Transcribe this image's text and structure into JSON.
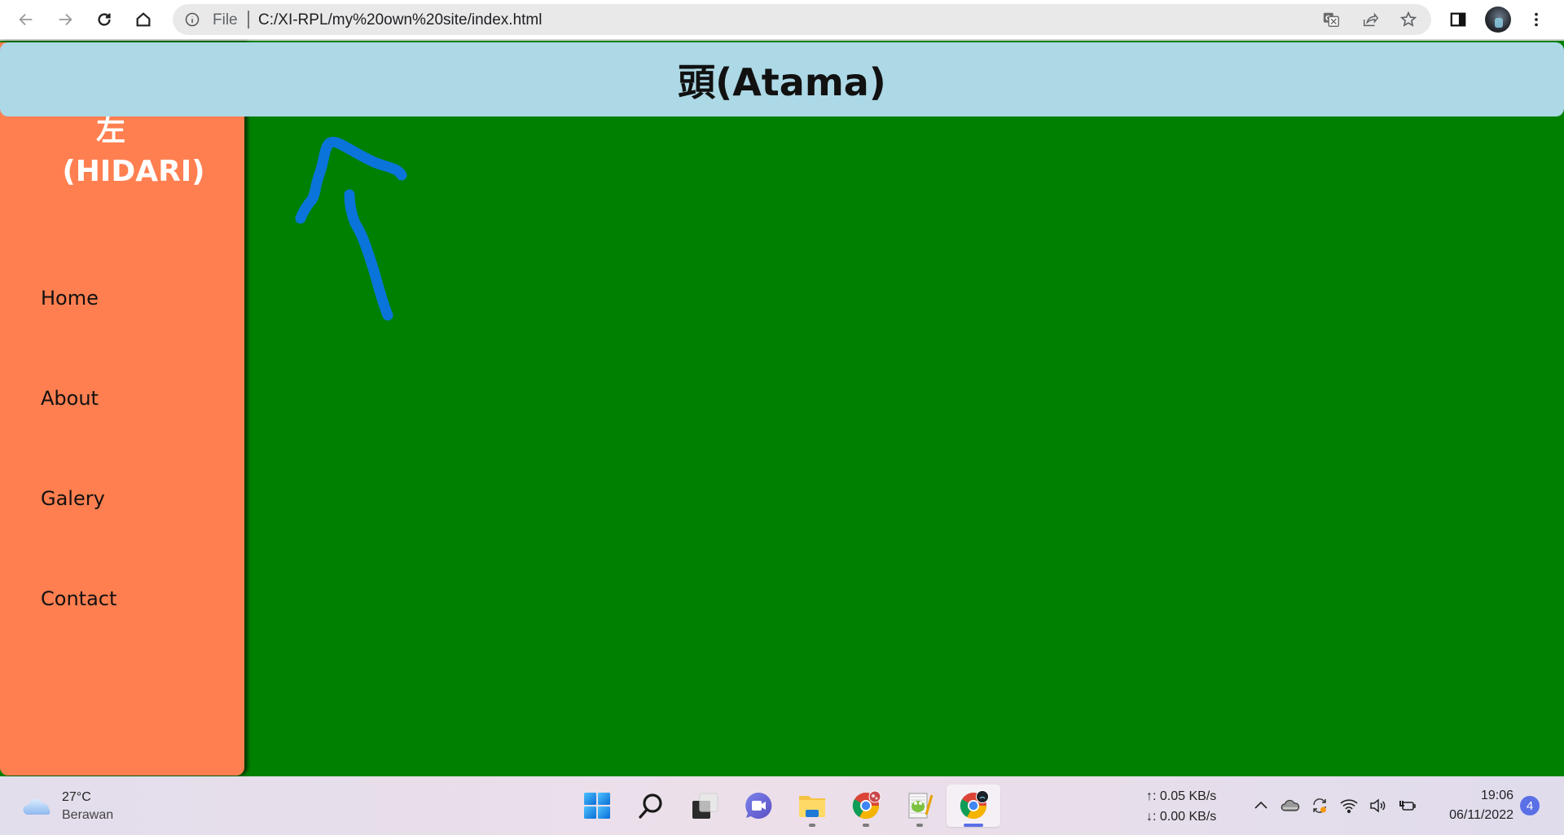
{
  "browser": {
    "address_scheme_label": "File",
    "url": "C:/XI-RPL/my%20own%20site/index.html",
    "icons": {
      "back": "arrow-left-icon",
      "forward": "arrow-right-icon",
      "reload": "reload-icon",
      "home": "home-icon",
      "site_info": "info-icon",
      "translate": "translate-icon",
      "share": "share-icon",
      "bookmark": "star-icon",
      "side_panel": "side-panel-icon",
      "profile": "profile-avatar",
      "menu": "kebab-menu-icon"
    }
  },
  "page": {
    "header_title": "頭(Atama)",
    "sidebar": {
      "title_kanji": "左",
      "title_romaji": "(HIDARI)",
      "nav": [
        {
          "label": "Home"
        },
        {
          "label": "About"
        },
        {
          "label": "Galery"
        },
        {
          "label": "Contact"
        }
      ]
    },
    "annotation": {
      "type": "hand-drawn-arrow",
      "direction": "up",
      "color": "#0a74da"
    },
    "colors": {
      "header_bg": "#add8e6",
      "sidebar_bg": "#ff7f50",
      "content_bg": "#008000",
      "sidebar_title_text": "#ffffff"
    }
  },
  "taskbar": {
    "weather": {
      "temperature": "27°C",
      "condition": "Berawan"
    },
    "apps": [
      {
        "name": "start",
        "icon": "windows-start-icon",
        "running": false,
        "active": false
      },
      {
        "name": "search",
        "icon": "search-icon",
        "running": false,
        "active": false
      },
      {
        "name": "task-view",
        "icon": "task-view-icon",
        "running": false,
        "active": false
      },
      {
        "name": "chat",
        "icon": "teams-chat-icon",
        "running": false,
        "active": false
      },
      {
        "name": "file-explorer",
        "icon": "folder-icon",
        "running": true,
        "active": false
      },
      {
        "name": "chrome-profile-1",
        "icon": "chrome-icon",
        "running": true,
        "active": false
      },
      {
        "name": "notepad-plus-plus",
        "icon": "notepadpp-icon",
        "running": true,
        "active": false
      },
      {
        "name": "chrome-profile-2",
        "icon": "chrome-icon",
        "running": true,
        "active": true
      }
    ],
    "network_speed": {
      "upload": "↑: 0.05 KB/s",
      "download": "↓: 0.00 KB/s"
    },
    "tray_icons": [
      "chevron-up-icon",
      "onedrive-cloud-icon",
      "sync-icon",
      "wifi-icon",
      "volume-icon",
      "battery-charging-icon"
    ],
    "clock": {
      "time": "19:06",
      "date": "06/11/2022"
    },
    "notification_count": "4"
  }
}
